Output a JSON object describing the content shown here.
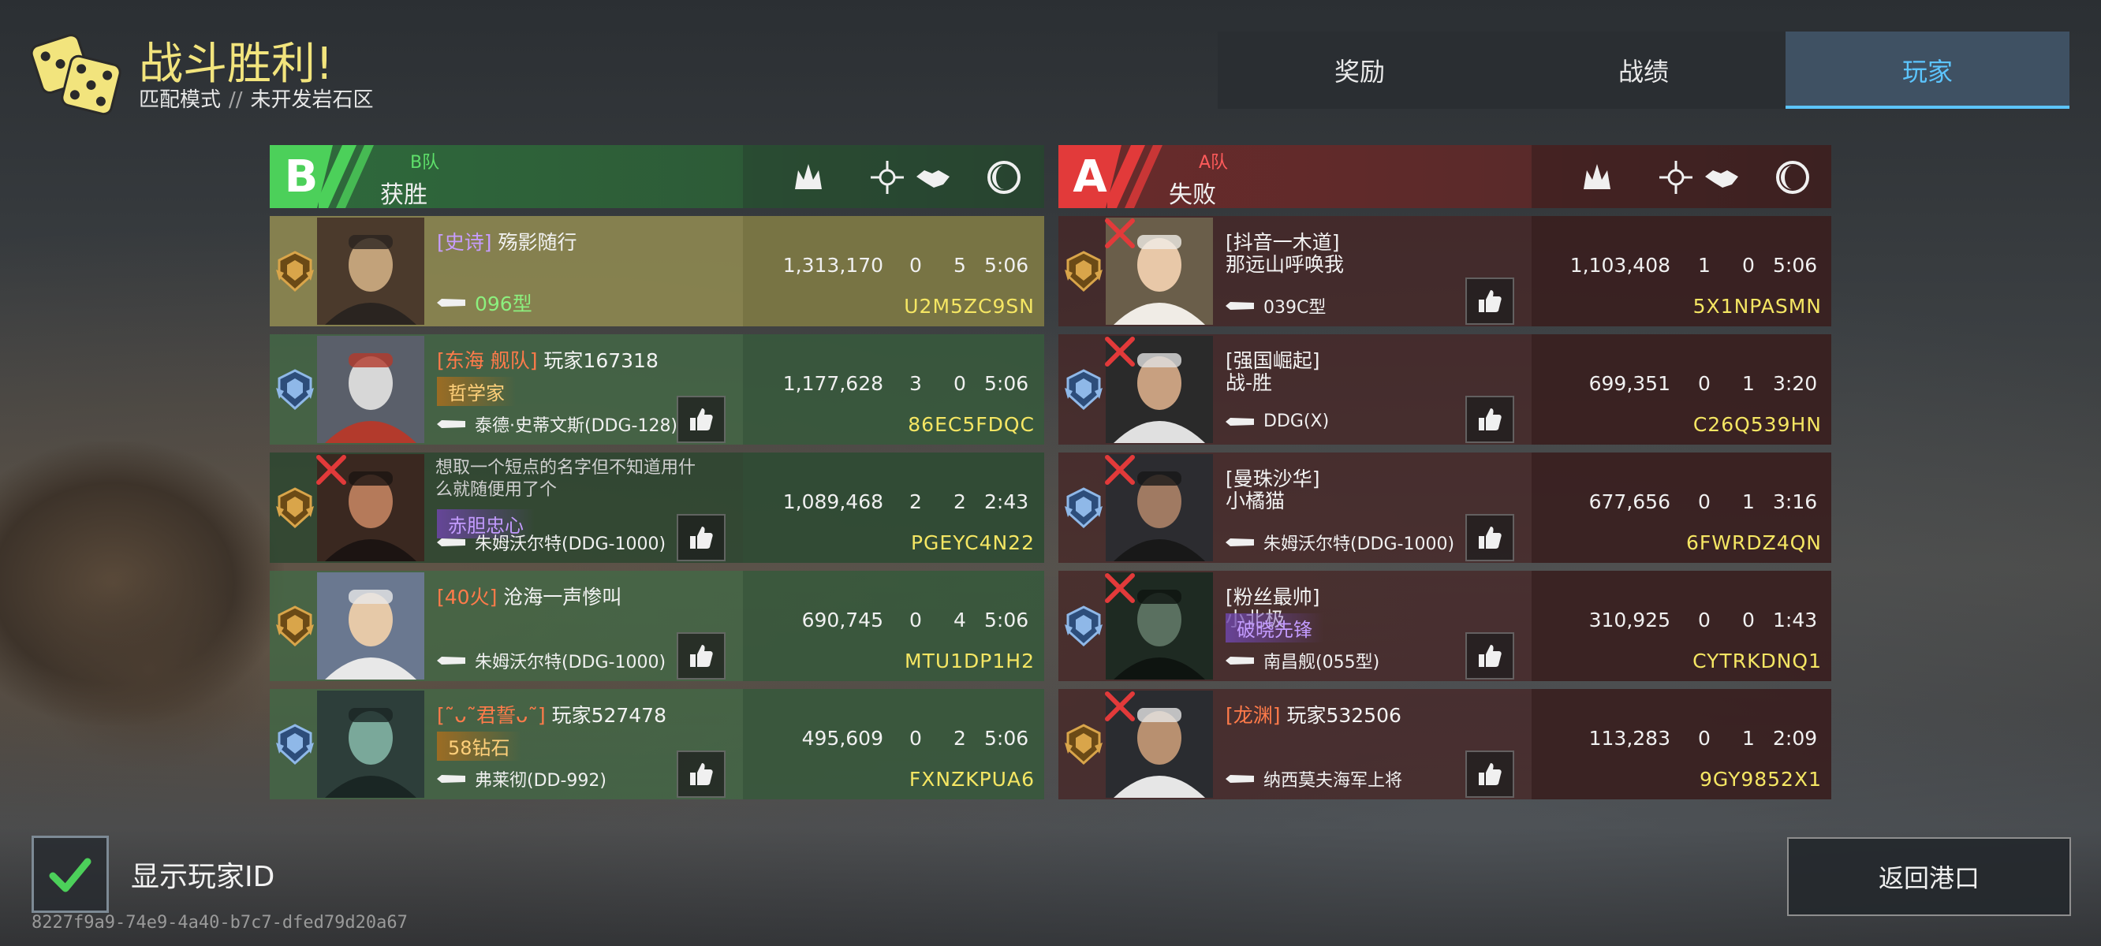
{
  "header": {
    "title": "战斗胜利!",
    "mode": "匹配模式",
    "separator": "//",
    "map": "未开发岩石区",
    "logo_icon": "dice-icon"
  },
  "tabs": [
    {
      "label": "奖励",
      "active": false
    },
    {
      "label": "战绩",
      "active": false
    },
    {
      "label": "玩家",
      "active": true
    }
  ],
  "column_icons": [
    "damage-icon",
    "kills-icon",
    "assists-icon",
    "survival-time-icon"
  ],
  "team_b": {
    "letter": "B",
    "tag": "B队",
    "result": "获胜",
    "color": "#4cd05a",
    "players": [
      {
        "clan": "[史诗]",
        "name": "殇影随行",
        "badge": "",
        "ship": "096型",
        "score": "1,313,170",
        "kills": "0",
        "assists": "5",
        "time": "5:06",
        "id": "U2M5ZC9SN",
        "mvp": true,
        "dead": false,
        "rank": "gold-star-rank"
      },
      {
        "clan": "[东海 舰队]",
        "name": "玩家167318",
        "badge": "哲学家",
        "ship": "泰德·史蒂文斯(DDG-128)",
        "score": "1,177,628",
        "kills": "3",
        "assists": "0",
        "time": "5:06",
        "id": "86EC5FDQC",
        "mvp": false,
        "dead": false,
        "rank": "silver-star-rank"
      },
      {
        "clan": "",
        "name": "想取一个短点的名字但不知道用什么就随便用了个",
        "badge": "赤胆忠心",
        "ship": "朱姆沃尔特(DDG-1000)",
        "score": "1,089,468",
        "kills": "2",
        "assists": "2",
        "time": "2:43",
        "id": "PGEYC4N22",
        "mvp": false,
        "dead": true,
        "rank": "gold-rank"
      },
      {
        "clan": "[40火]",
        "name": "沧海一声惨叫",
        "badge": "",
        "ship": "朱姆沃尔特(DDG-1000)",
        "score": "690,745",
        "kills": "0",
        "assists": "4",
        "time": "5:06",
        "id": "MTU1DP1H2",
        "mvp": false,
        "dead": false,
        "rank": "gold-rank"
      },
      {
        "clan": "[˜ᴗ˜君誓ᴗ˜]",
        "name": "玩家527478",
        "badge": "58钻石",
        "ship": "弗莱彻(DD-992)",
        "score": "495,609",
        "kills": "0",
        "assists": "2",
        "time": "5:06",
        "id": "FXNZKPUA6",
        "mvp": false,
        "dead": false,
        "rank": "silver-star-rank"
      }
    ]
  },
  "team_a": {
    "letter": "A",
    "tag": "A队",
    "result": "失败",
    "color": "#e23a3a",
    "players": [
      {
        "clan": "[抖音一木道]",
        "name": "那远山呼唤我",
        "badge": "",
        "ship": "039C型",
        "score": "1,103,408",
        "kills": "1",
        "assists": "0",
        "time": "5:06",
        "id": "5X1NPASMN",
        "dead": true,
        "rank": "gold-rank"
      },
      {
        "clan": "[强国崛起]",
        "name": "战-胜",
        "badge": "",
        "ship": "DDG(X)",
        "score": "699,351",
        "kills": "0",
        "assists": "1",
        "time": "3:20",
        "id": "C26Q539HN",
        "dead": true,
        "rank": "silver-star-rank"
      },
      {
        "clan": "[曼珠沙华]",
        "name": "小橘猫",
        "badge": "",
        "ship": "朱姆沃尔特(DDG-1000)",
        "score": "677,656",
        "kills": "0",
        "assists": "1",
        "time": "3:16",
        "id": "6FWRDZ4QN",
        "dead": true,
        "rank": "silver-star-rank"
      },
      {
        "clan": "[粉丝最帅]",
        "name": "小北极",
        "badge": "破晓先锋",
        "ship": "南昌舰(055型)",
        "score": "310,925",
        "kills": "0",
        "assists": "0",
        "time": "1:43",
        "id": "CYTRKDNQ1",
        "dead": true,
        "rank": "silver-star-rank"
      },
      {
        "clan": "[龙渊]",
        "name": "玩家532506",
        "badge": "",
        "ship": "纳西莫夫海军上将",
        "score": "113,283",
        "kills": "0",
        "assists": "1",
        "time": "2:09",
        "id": "9GY9852X1",
        "dead": true,
        "rank": "gold-rank"
      }
    ]
  },
  "footer": {
    "show_id_label": "显示玩家ID",
    "show_id_checked": true,
    "session_id": "8227f9a9-74e9-4a40-b7c7-dfed79d20a67",
    "return_label": "返回港口"
  }
}
